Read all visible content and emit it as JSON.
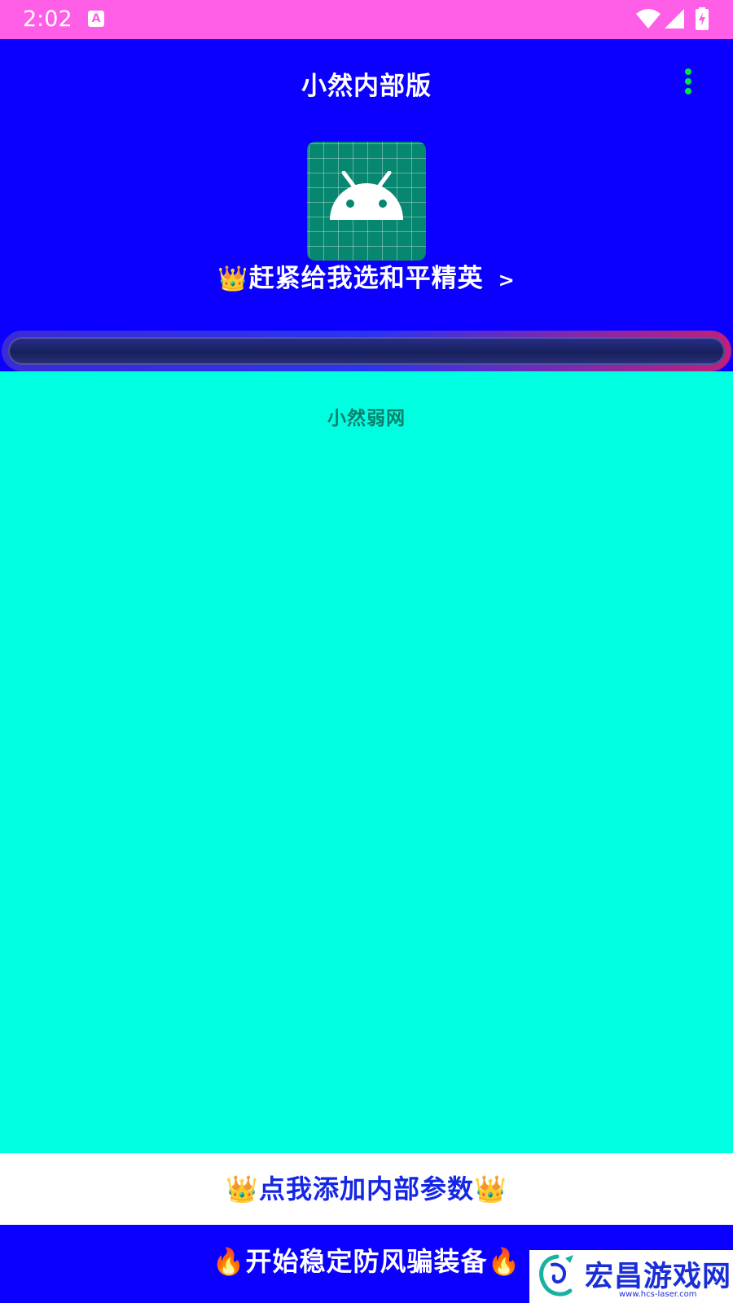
{
  "status_bar": {
    "time": "2:02",
    "notification_glyph": "A",
    "icons": [
      "wifi-icon",
      "signal-icon",
      "battery-charging-icon"
    ],
    "background": "#ff5ee6"
  },
  "header": {
    "title": "小然内部版",
    "menu_icon": "more-vert-icon",
    "background": "#0b00ff"
  },
  "app_icon": {
    "name": "android-icon",
    "background": "#07876f"
  },
  "selector": {
    "crown": "👑",
    "label": "赶紧给我选和平精英",
    "arrow": ">"
  },
  "progress": {
    "value": 0
  },
  "content": {
    "label": "小然弱网",
    "background": "#00ffe1"
  },
  "buttons": {
    "add_params": {
      "left_emoji": "👑",
      "label": "点我添加内部参数",
      "right_emoji": "👑"
    },
    "start": {
      "left_emoji": "🔥",
      "label": "开始稳定防风骗装备",
      "right_emoji": "🔥"
    }
  },
  "watermark": {
    "text": "宏昌游戏网",
    "url": "www.hcs-laser.com"
  }
}
